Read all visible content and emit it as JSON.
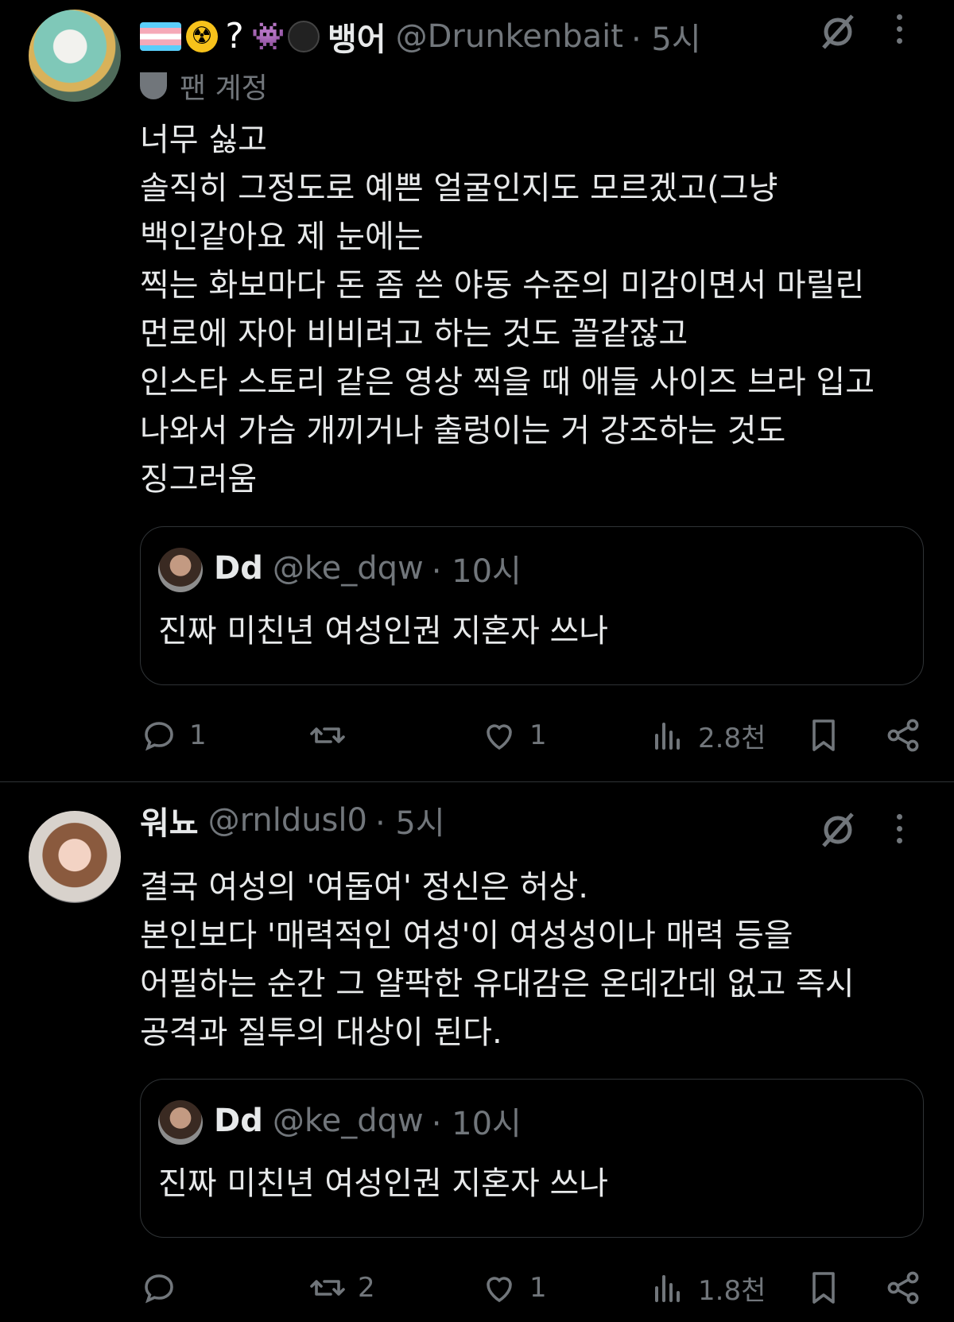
{
  "tweets": [
    {
      "emojis": [
        "transgender-flag",
        "radioactive",
        "question-mark",
        "alien-monster",
        "bomb"
      ],
      "name": "뱅어",
      "handle": "@Drunkenbait",
      "time": "· 5시",
      "fan_label": "팬 계정",
      "body": "너무 싫고\n솔직히 그정도로 예쁜 얼굴인지도 모르겠고(그냥\n백인같아요 제 눈에는\n찍는 화보마다 돈 좀 쓴 야동 수준의 미감이면서 마릴린\n먼로에 자아 비비려고 하는 것도 꼴같잖고\n인스타 스토리 같은 영상 찍을 때 애들 사이즈 브라 입고\n나와서 가슴 개끼거나 출렁이는 거 강조하는 것도\n징그러움",
      "quote": {
        "name": "Dd",
        "handle": "@ke_dqw",
        "time": "· 10시",
        "text": "진짜 미친년 여성인권 지혼자 쓰나"
      },
      "actions": {
        "replies": "1",
        "retweets": "",
        "likes": "1",
        "views": "2.8천"
      }
    },
    {
      "name": "워뇨",
      "handle": "@rnldusl0",
      "time": "· 5시",
      "body": "결국 여성의 '여돕여' 정신은 허상.\n본인보다 '매력적인 여성'이 여성성이나 매력 등을\n어필하는 순간 그 얄팍한 유대감은 온데간데 없고 즉시\n공격과 질투의 대상이 된다.",
      "quote": {
        "name": "Dd",
        "handle": "@ke_dqw",
        "time": "· 10시",
        "text": "진짜 미친년 여성인권 지혼자 쓰나"
      },
      "actions": {
        "replies": "",
        "retweets": "2",
        "likes": "1",
        "views": "1.8천"
      }
    }
  ],
  "colors": {
    "background": "#000000",
    "text": "#e7e9ea",
    "muted": "#71767b",
    "border": "#2f3336"
  }
}
